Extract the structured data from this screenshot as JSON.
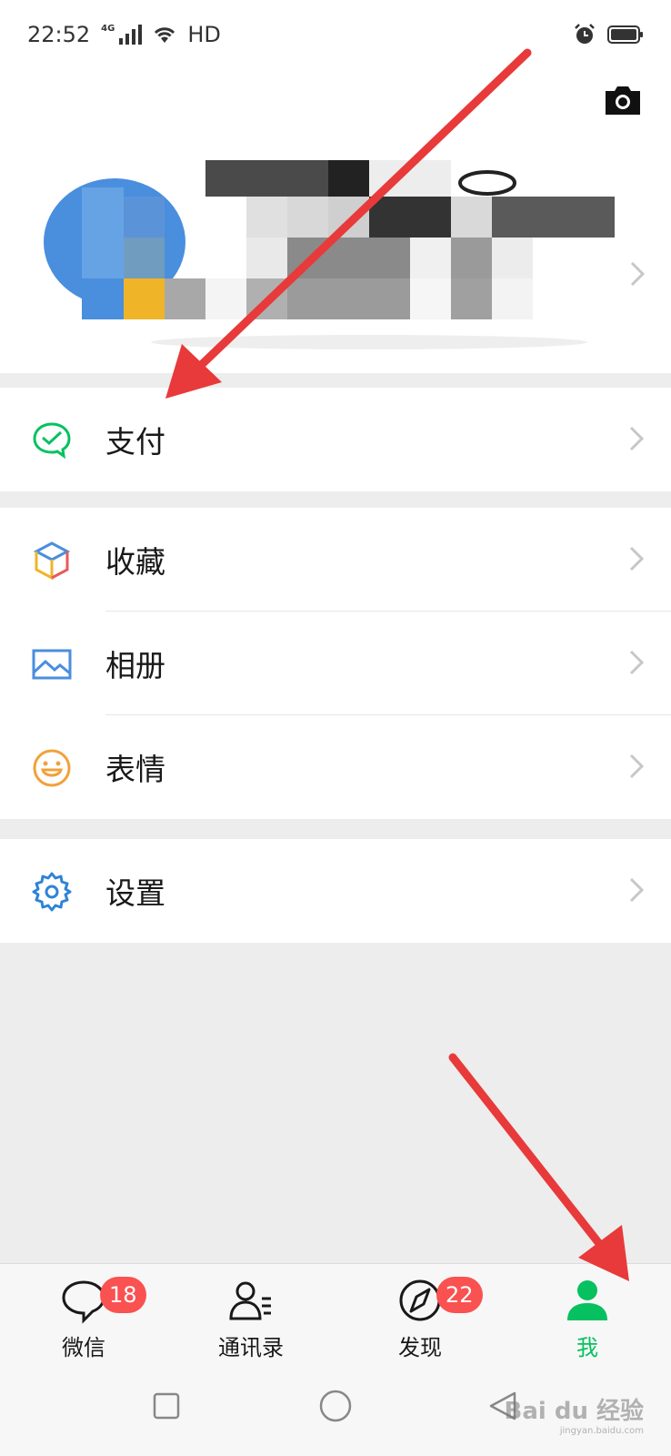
{
  "status_bar": {
    "time": "22:52",
    "network": "4G",
    "hd": "HD"
  },
  "header": {
    "camera_icon": "camera-icon",
    "profile_obscured": true
  },
  "menu": {
    "pay": "支付",
    "favorites": "收藏",
    "album": "相册",
    "stickers": "表情",
    "settings": "设置"
  },
  "tabs": [
    {
      "label": "微信",
      "badge": "18",
      "icon": "chat-bubble-icon"
    },
    {
      "label": "通讯录",
      "badge": "",
      "icon": "contacts-icon"
    },
    {
      "label": "发现",
      "badge": "22",
      "icon": "compass-icon"
    },
    {
      "label": "我",
      "badge": "",
      "icon": "me-person-icon",
      "active": true
    }
  ],
  "watermark": {
    "brand": "Bai du 经验",
    "url": "jingyan.baidu.com"
  },
  "colors": {
    "accent_green": "#07c160",
    "badge_red": "#fa5151",
    "arrow_red": "#e83a3a"
  }
}
